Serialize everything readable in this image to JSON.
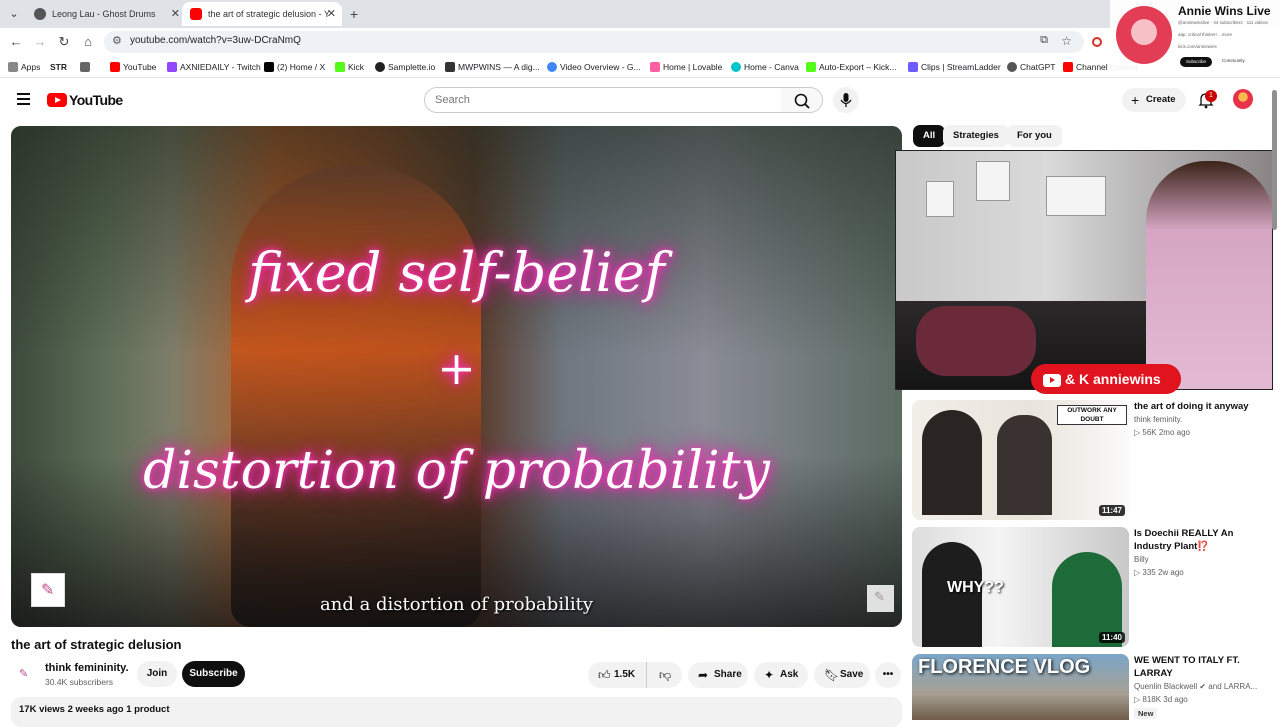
{
  "browser": {
    "tabs": [
      {
        "title": "Leong Lau - Ghost Drums",
        "active": false
      },
      {
        "title": "the art of strategic delusion - Y",
        "active": true
      }
    ],
    "url": "youtube.com/watch?v=3uw-DCraNmQ",
    "bookmarks": [
      "Apps",
      "STR",
      "YouTube",
      "AXNIEDAILY - Twitch",
      "(2) Home / X",
      "Kick",
      "Samplette.io",
      "MWPWINS — A dig...",
      "Video Overview - G...",
      "Home | Lovable",
      "Home - Canva",
      "Auto-Export – Kick...",
      "Clips | StreamLadder",
      "ChatGPT",
      "Channel content"
    ]
  },
  "stream_overlay": {
    "name": "Annie Wins Live",
    "subline": "@anniewinslive · 44 subscribers · 111 videos",
    "desc": "aap, critical thinker! ...more",
    "link": "kick.com/anniewins",
    "subscribe": "Subscribe",
    "community": "Community",
    "banner": "& K anniewins"
  },
  "header": {
    "logo": "YouTube",
    "search_placeholder": "Search",
    "create": "Create",
    "notif_count": "1"
  },
  "player": {
    "line1": "fixed self-belief",
    "line2": "+",
    "line3": "distortion of probability",
    "caption": "and a distortion of probability"
  },
  "video": {
    "title": "the art of strategic delusion",
    "channel": "think femininity.",
    "subscribers": "30.4K subscribers",
    "join": "Join",
    "subscribe": "Subscribe",
    "likes": "1.5K",
    "share": "Share",
    "ask": "Ask",
    "save": "Save",
    "meta": "17K views  2 weeks ago  1 product"
  },
  "sidebar": {
    "chips": [
      "All",
      "Strategies",
      "For you"
    ],
    "recs": [
      {
        "title": "the art of doing it anyway",
        "channel": "think feminity.",
        "meta": "▷ 56K   2mo ago",
        "duration": "11:47",
        "thumb_text": "OUTWORK ANY DOUBT"
      },
      {
        "title": "Is Doechii REALLY An Industry Plant⁉️",
        "channel": "Billy",
        "meta": "▷ 335   2w ago",
        "duration": "11:40",
        "thumb_text": "WHY??"
      },
      {
        "title": "WE WENT TO ITALY FT. LARRAY",
        "channel": "Quenlin Blackwell ✔ and LARRA...",
        "meta": "▷ 818K   3d ago",
        "badge": "New",
        "thumb_text": "FLORENCE VLOG"
      }
    ]
  }
}
